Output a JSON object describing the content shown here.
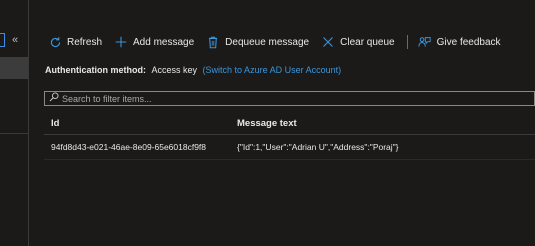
{
  "sidebar": {
    "collapse_glyph": "«"
  },
  "toolbar": {
    "refresh_label": "Refresh",
    "add_label": "Add message",
    "dequeue_label": "Dequeue message",
    "clear_label": "Clear queue",
    "feedback_label": "Give feedback"
  },
  "auth": {
    "label": "Authentication method:",
    "value": "Access key",
    "link": "(Switch to Azure AD User Account)"
  },
  "filter": {
    "placeholder": "Search to filter items..."
  },
  "table": {
    "columns": [
      "Id",
      "Message text"
    ],
    "rows": [
      {
        "id": "94fd8d43-e021-46ae-8e09-65e6018cf9f8",
        "message": "{\"Id\":1,\"User\":\"Adrian U\",\"Address\":\"Poraj\"}"
      }
    ]
  },
  "colors": {
    "background": "#1b1a19",
    "accent": "#3a96dd",
    "text": "#e8e8e8"
  },
  "icons": [
    "refresh-icon",
    "add-icon",
    "trash-icon",
    "close-icon",
    "feedback-icon",
    "search-icon"
  ]
}
